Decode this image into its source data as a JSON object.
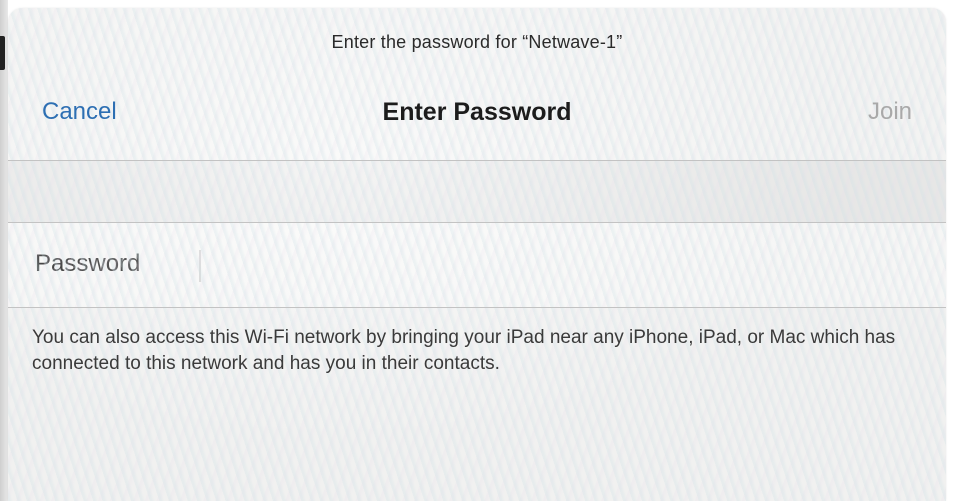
{
  "dialog": {
    "prompt": "Enter the password for “Netwave-1”",
    "title": "Enter Password",
    "cancel_label": "Cancel",
    "join_label": "Join",
    "join_enabled": false
  },
  "password_field": {
    "label": "Password",
    "value": ""
  },
  "footer": {
    "note": "You can also access this Wi-Fi network by bringing your iPad near any iPhone, iPad, or Mac which has connected to this network and has you in their contacts."
  },
  "colors": {
    "accent": "#2d6fb3",
    "disabled": "#a9a9a9",
    "separator": "#c3c3c3"
  }
}
